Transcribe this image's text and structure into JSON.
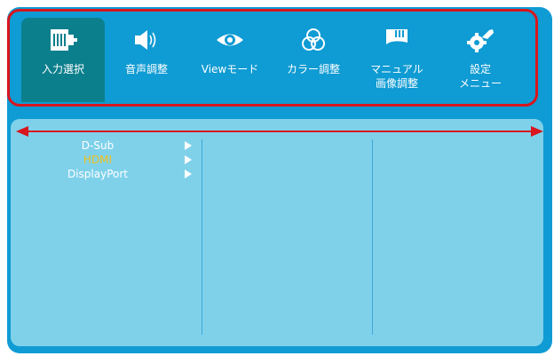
{
  "top_menu": {
    "items": [
      {
        "label": "入力選択",
        "icon": "input-select-icon",
        "selected": true
      },
      {
        "label": "音声調整",
        "icon": "speaker-icon",
        "selected": false
      },
      {
        "label": "Viewモード",
        "icon": "eye-icon",
        "selected": false
      },
      {
        "label": "カラー調整",
        "icon": "color-circles-icon",
        "selected": false
      },
      {
        "label": "マニュアル\n画像調整",
        "icon": "picture-adjust-icon",
        "selected": false
      },
      {
        "label": "設定\nメニュー",
        "icon": "gear-wrench-icon",
        "selected": false
      }
    ]
  },
  "input_list": {
    "items": [
      {
        "label": "D-Sub",
        "selected": false
      },
      {
        "label": "HDMI",
        "selected": true
      },
      {
        "label": "DisplayPort",
        "selected": false
      }
    ]
  },
  "colors": {
    "background": "#0f9bd3",
    "panel": "#7fd1ea",
    "selected_tab": "#0c7f8d",
    "highlight_border": "#d9151d",
    "selected_text": "#f3c21b"
  }
}
